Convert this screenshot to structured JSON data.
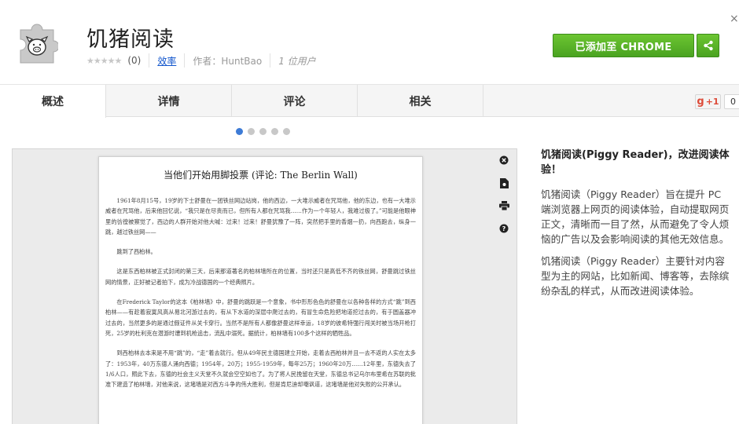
{
  "header": {
    "title": "饥猪阅读",
    "rating_count": "(0)",
    "category": "效率",
    "author": "作者：HuntBao",
    "users": "1 位用户",
    "add_button": "已添加至 CHROME",
    "close": "×"
  },
  "tabs": [
    {
      "label": "概述"
    },
    {
      "label": "详情"
    },
    {
      "label": "评论"
    },
    {
      "label": "相关"
    }
  ],
  "gplus": {
    "label": "+1",
    "count": "0"
  },
  "carousel": {
    "total": 5,
    "active": 0
  },
  "screenshot": {
    "title": "当他们开始用脚投票 (评论: The Berlin Wall)",
    "paragraphs": [
      "1961年8月15号，19岁的下士舒曼在一团铁丝网边站岗，他的西边，一大堆示威者在咒骂他，他的东边，也有一大堆示威者在咒骂他，后来他回忆说，“我只是在尽责而已，但所有人都在咒骂我……作为一个年轻人，我难过极了。”可能是他眼神里的彷徨被察觉了，西边的人群开始对他大喊：过来！过来！舒曼犹豫了一阵，突然把手里的香烟一扔，向西跑去，纵身一跳，越过铁丝网——",
      "跳到了西柏林。",
      "这是东西柏林被正式封闭的第三天，后来那道著名的柏林墙所在的位置，当时还只是高低不齐的铁丝网，舒曼跳过铁丝网的情景，正好被记者拍下，成为冷战德国的一个经典照片。",
      "在Frederick Taylor的这本《柏林墙》中，舒曼的跳跃是一个意象，书中形形色色的舒曼在以各种各样的方式“跳”到西柏林——有趁着寂寞风高从易北河游过去的，有从下水道的深层中爬过去的，有冒生命危险把地道挖过去的，有于圆盖器冲过去的，当然更多的是通过假证件从关卡穿行。当然不是所有人都像舒曼这样幸运，18岁的彼希特强行闯关时被当场开枪打死，25岁的杜利克在潜游时遭到机枪追击，流乱中溺死。据统计，柏林墙有100多个这样的牺牲品。",
      "到西柏林去本来是不用“跳”的，“走”着去就行。但从49年民主德国建立开始，走着去西柏林并且一去不返的人实在太多了：1953年，40万东德人涌向西德；1954年，20万；1955-1959年，每年25万；1960年20万……12年里，东德失去了1/6人口，照此下去，东德的社会主义天堂不久就会空空如也了。为了将人民挽留在天堂，东德总书记乌尔布里希在苏联的批准下建造了柏林墙，对他来说，这堵墙是对西方斗争的伟大胜利，但是肯尼迪却嘲讽道，这堵墙是他对失败的公开承认。"
    ]
  },
  "description": {
    "heading": "饥猪阅读(Piggy Reader)，改进阅读体验！",
    "paragraphs": [
      "饥猪阅读（Piggy Reader）旨在提升 PC 端浏览器上网页的阅读体验，自动提取网页正文，清晰而一目了然，从而避免了令人烦恼的广告以及会影响阅读的其他无效信息。",
      "饥猪阅读（Piggy Reader）主要针对内容型为主的网站，比如新闻、博客等，去除缤纷杂乱的样式，从而改进阅读体验。"
    ]
  },
  "colors": {
    "accent_green": "#4aa321",
    "link_blue": "#1155cc",
    "dot_active": "#3d7bd6"
  }
}
